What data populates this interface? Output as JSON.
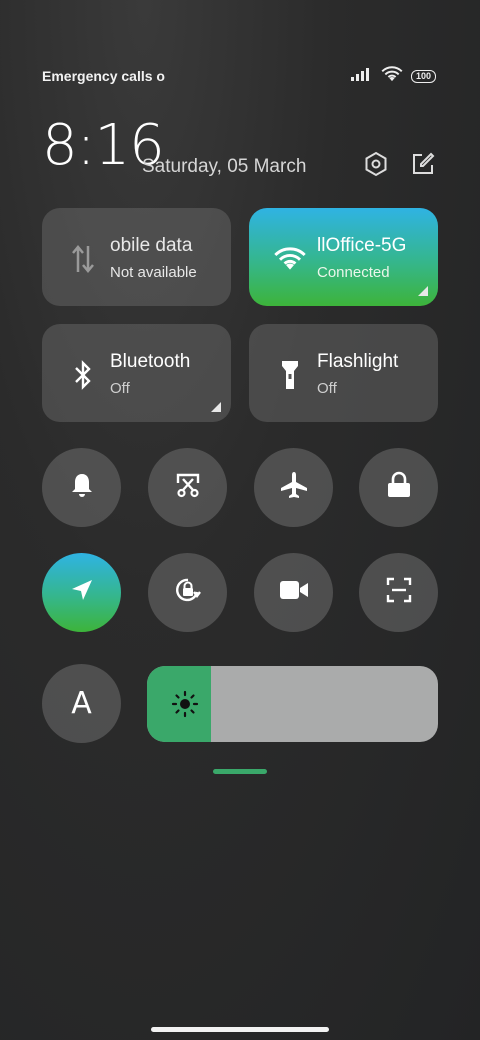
{
  "status_bar": {
    "carrier_text": "Emergency calls o",
    "battery": "100",
    "icons": [
      "signal-icon",
      "wifi-icon",
      "battery-icon"
    ]
  },
  "header": {
    "time": "8:16",
    "date": "Saturday, 05 March",
    "icons": [
      "settings-icon",
      "edit-icon"
    ]
  },
  "tiles": [
    {
      "name": "obile data",
      "state": "Not available",
      "icon": "mobile-data-icon",
      "active": false
    },
    {
      "name": "llOffice-5G",
      "state": "Connected",
      "icon": "wifi-icon",
      "active": true
    },
    {
      "name": "Bluetooth",
      "state": "Off",
      "icon": "bluetooth-icon",
      "active": false
    },
    {
      "name": "Flashlight",
      "state": "Off",
      "icon": "flashlight-icon",
      "active": false
    }
  ],
  "toggles": [
    {
      "icon": "bell-icon",
      "active": false
    },
    {
      "icon": "screenshot-icon",
      "active": false
    },
    {
      "icon": "airplane-icon",
      "active": false
    },
    {
      "icon": "lock-icon",
      "active": false
    },
    {
      "icon": "location-icon",
      "active": true
    },
    {
      "icon": "rotation-lock-icon",
      "active": false
    },
    {
      "icon": "screen-record-icon",
      "active": false
    },
    {
      "icon": "scanner-icon",
      "active": false
    },
    {
      "icon": "font-icon",
      "label": "A",
      "active": false
    }
  ],
  "brightness": {
    "level": 0.22,
    "icon": "sun-icon"
  },
  "colors": {
    "accent_green": "#3aa86a",
    "accent_blue": "#2fb3e3",
    "tile_bg": "#5a5a5a"
  }
}
